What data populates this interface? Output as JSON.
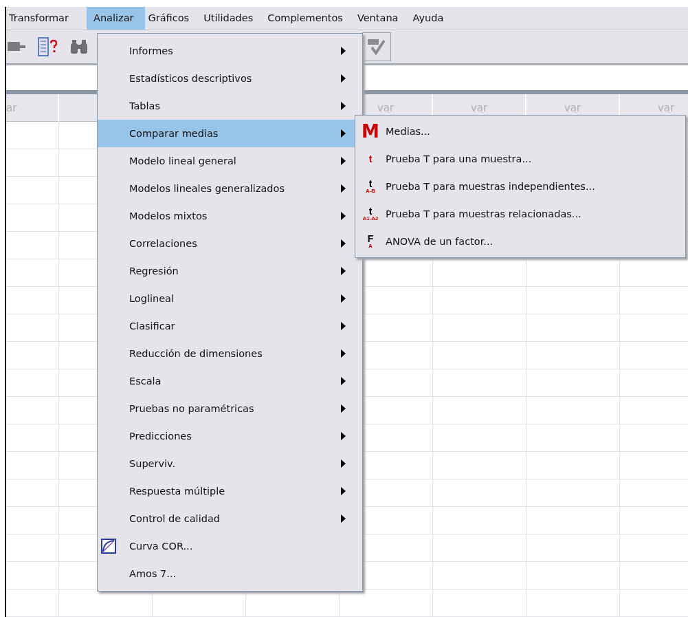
{
  "menubar": [
    {
      "label": "Transformar",
      "selected": false
    },
    {
      "label": "Analizar",
      "selected": true
    },
    {
      "label": "Gráficos",
      "selected": false
    },
    {
      "label": "Utilidades",
      "selected": false
    },
    {
      "label": "Complementos",
      "selected": false
    },
    {
      "label": "Ventana",
      "selected": false
    },
    {
      "label": "Ayuda",
      "selected": false
    }
  ],
  "grid": {
    "columns": [
      {
        "kind": "labeled",
        "label": "ar"
      },
      {
        "kind": "blank"
      },
      {
        "kind": "blank"
      },
      {
        "kind": "blank"
      },
      {
        "kind": "labeled",
        "label": "var"
      },
      {
        "kind": "labeled",
        "label": "var"
      },
      {
        "kind": "labeled",
        "label": "var"
      },
      {
        "kind": "labeled",
        "label": "var"
      }
    ]
  },
  "menu": {
    "items": [
      {
        "label": "Informes",
        "kind": "submenu",
        "selected": false
      },
      {
        "label": "Estadísticos descriptivos",
        "kind": "submenu",
        "selected": false
      },
      {
        "label": "Tablas",
        "kind": "submenu",
        "selected": false
      },
      {
        "label": "Comparar medias",
        "kind": "submenu",
        "selected": true
      },
      {
        "label": "Modelo lineal general",
        "kind": "submenu",
        "selected": false
      },
      {
        "label": "Modelos lineales generalizados",
        "kind": "submenu",
        "selected": false
      },
      {
        "label": "Modelos mixtos",
        "kind": "submenu",
        "selected": false
      },
      {
        "label": "Correlaciones",
        "kind": "submenu",
        "selected": false
      },
      {
        "label": "Regresión",
        "kind": "submenu",
        "selected": false
      },
      {
        "label": "Loglineal",
        "kind": "submenu",
        "selected": false
      },
      {
        "label": "Clasificar",
        "kind": "submenu",
        "selected": false
      },
      {
        "label": "Reducción de dimensiones",
        "kind": "submenu",
        "selected": false
      },
      {
        "label": "Escala",
        "kind": "submenu",
        "selected": false
      },
      {
        "label": "Pruebas no paramétricas",
        "kind": "submenu",
        "selected": false
      },
      {
        "label": "Predicciones",
        "kind": "submenu",
        "selected": false
      },
      {
        "label": "Superviv.",
        "kind": "submenu",
        "selected": false
      },
      {
        "label": "Respuesta múltiple",
        "kind": "submenu",
        "selected": false
      },
      {
        "label": "Control de calidad",
        "kind": "submenu",
        "selected": false
      },
      {
        "label": "Curva COR...",
        "kind": "roc",
        "selected": false
      },
      {
        "label": "Amos 7...",
        "kind": "plain",
        "selected": false
      }
    ]
  },
  "submenu": {
    "items": [
      {
        "label": "Medias...",
        "icon": "M",
        "kind": "big"
      },
      {
        "label": "Prueba T para una muestra...",
        "icon": "t",
        "kind": "small"
      },
      {
        "label": "Prueba T para muestras independientes...",
        "icon": "t",
        "icon_sub": "A-B",
        "kind": "stacked"
      },
      {
        "label": "Prueba T para muestras relacionadas...",
        "icon": "t",
        "icon_sub": "A1-A2",
        "kind": "stacked"
      },
      {
        "label": "ANOVA de un factor...",
        "icon": "F",
        "icon_sub": "A",
        "kind": "stacked"
      }
    ]
  }
}
